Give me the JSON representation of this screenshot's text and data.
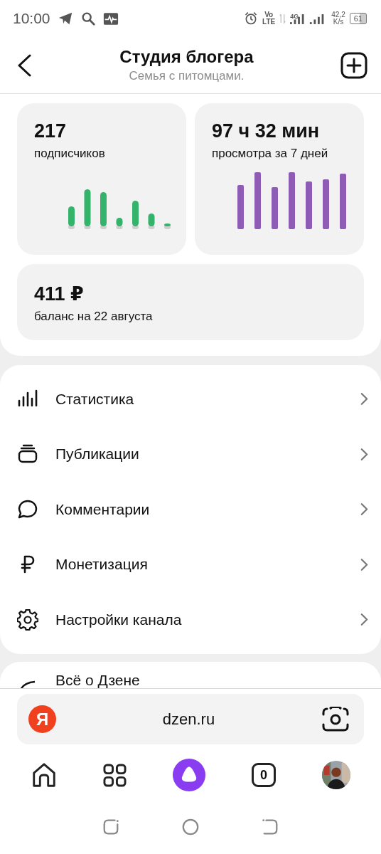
{
  "status_bar": {
    "time": "10:00",
    "volte_top": "Vo",
    "volte_bottom": "LTE",
    "network": "4G",
    "speed_value": "42,2",
    "speed_unit": "K/s",
    "battery": "61"
  },
  "header": {
    "title": "Студия блогера",
    "subtitle": "Семья с питомцами."
  },
  "stats": [
    {
      "kind": "subscribers",
      "value": "217",
      "label": "подписчиков"
    },
    {
      "kind": "views",
      "value": "97 ч 32 мин",
      "label": "просмотра за 7 дней"
    },
    {
      "kind": "balance",
      "value": "411 ₽",
      "label": "баланс на 22 августа"
    }
  ],
  "menu": [
    {
      "kind": "stats",
      "label": "Статистика"
    },
    {
      "kind": "publications",
      "label": "Публикации"
    },
    {
      "kind": "comments",
      "label": "Комментарии"
    },
    {
      "kind": "money",
      "label": "Монетизация"
    },
    {
      "kind": "settings",
      "label": "Настройки канала"
    }
  ],
  "next_card": {
    "label": "Всё о Дзене"
  },
  "browser": {
    "logo": "Я",
    "address": "dzen.ru",
    "tabs_count": "0"
  }
}
